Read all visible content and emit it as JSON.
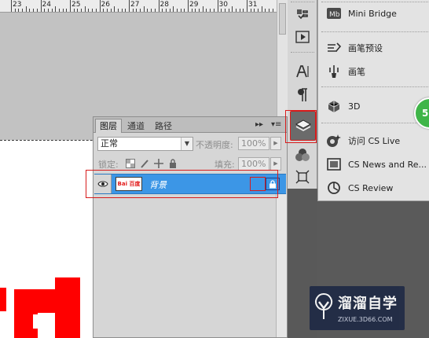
{
  "ruler": {
    "numbers": [
      "23",
      "24",
      "25",
      "26",
      "27",
      "28",
      "29",
      "30",
      "31"
    ]
  },
  "dock": {
    "icons": [
      "history-icon",
      "actions-play-icon",
      "character-icon",
      "paragraph-icon",
      "layers-icon",
      "channels-icon",
      "transform-icon"
    ],
    "active": "layers-icon"
  },
  "menu": {
    "items": [
      {
        "label": "Mini Bridge",
        "icon": "mini-bridge-icon"
      },
      {
        "label": "画笔预设",
        "icon": "brush-presets-icon"
      },
      {
        "label": "画笔",
        "icon": "brush-icon"
      },
      {
        "label": "3D",
        "icon": "3d-icon"
      },
      {
        "label": "访问 CS Live",
        "icon": "cs-live-icon"
      },
      {
        "label": "CS News and Re...",
        "icon": "cs-news-icon"
      },
      {
        "label": "CS Review",
        "icon": "cs-review-icon"
      }
    ],
    "badge": "5"
  },
  "layers_panel": {
    "tabs": [
      "图层",
      "通道",
      "路径"
    ],
    "active_tab": "图层",
    "blend_mode": "正常",
    "opacity_label": "不透明度:",
    "opacity_value": "100%",
    "lock_label": "锁定:",
    "fill_label": "填充:",
    "fill_value": "100%",
    "layers": [
      {
        "name": "背景",
        "thumb_text": "Bai 百度",
        "visible": true,
        "locked": true,
        "selected": true
      }
    ]
  },
  "watermark": {
    "title": "溜溜自学",
    "url": "ZIXUE.3D66.COM"
  },
  "colors": {
    "selection": "#3c96e6",
    "annotation": "#d81b1b",
    "shape_red": "#ff0000",
    "badge_green": "#3fb548"
  }
}
